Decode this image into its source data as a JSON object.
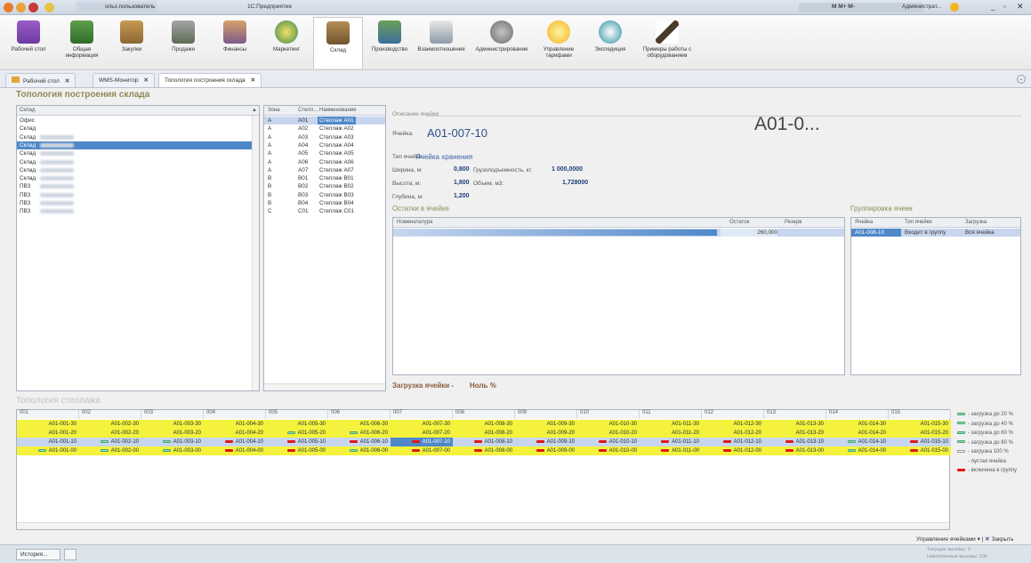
{
  "window": {
    "title_user": "ольз.пользователь",
    "title_app": "1С:Предприятие",
    "user": "Администрат..."
  },
  "ribbon": [
    {
      "label": "Рабочий стол",
      "icon": "desktop-icon"
    },
    {
      "label": "Общая информация",
      "icon": "info-icon"
    },
    {
      "label": "Закупки",
      "icon": "purchases-icon"
    },
    {
      "label": "Продажи",
      "icon": "sales-icon"
    },
    {
      "label": "Финансы",
      "icon": "finance-icon"
    },
    {
      "label": "Маркетинг",
      "icon": "marketing-icon"
    },
    {
      "label": "Склад",
      "icon": "warehouse-icon"
    },
    {
      "label": "Производство",
      "icon": "production-icon"
    },
    {
      "label": "Взаимоотношения",
      "icon": "relations-icon"
    },
    {
      "label": "Администрирование",
      "icon": "admin-icon"
    },
    {
      "label": "Управление тарифами",
      "icon": "tariff-icon"
    },
    {
      "label": "Экспедиция",
      "icon": "expedition-icon"
    },
    {
      "label": "Примеры работы с оборудованием",
      "icon": "equipment-icon"
    }
  ],
  "tabs": [
    "Рабочий стол",
    "WMS-Монитор",
    "Топология построения склада"
  ],
  "page_title": "Топология построения склада",
  "warehouses": {
    "header": "Склад",
    "items": [
      "Офис",
      "Склад",
      "Склад",
      "Склад",
      "Склад",
      "Склад",
      "Склад",
      "Склад",
      "ПВЗ",
      "ПВЗ",
      "ПВЗ",
      "ПВЗ"
    ]
  },
  "racks": {
    "headers": [
      "Зона",
      "Стелл...",
      "Наименование"
    ],
    "rows": [
      [
        "A",
        "A01",
        "Стеллаж A01"
      ],
      [
        "A",
        "A02",
        "Стеллаж A02"
      ],
      [
        "A",
        "A03",
        "Стеллаж A03"
      ],
      [
        "A",
        "A04",
        "Стеллаж A04"
      ],
      [
        "A",
        "A05",
        "Стеллаж A05"
      ],
      [
        "A",
        "A06",
        "Стеллаж A06"
      ],
      [
        "A",
        "A07",
        "Стеллаж A07"
      ],
      [
        "B",
        "B01",
        "Стеллаж B01"
      ],
      [
        "B",
        "B02",
        "Стеллаж B02"
      ],
      [
        "B",
        "B03",
        "Стеллаж B03"
      ],
      [
        "B",
        "B04",
        "Стеллаж B04"
      ],
      [
        "C",
        "C01",
        "Стеллаж C01"
      ]
    ]
  },
  "cell": {
    "section": "Описание ячейки",
    "cell_label": "Ячейка:",
    "cell_value": "A01-007-10",
    "big": "A01-0...",
    "type_label": "Тип ячейки:",
    "type_value": "Ячейка хранения",
    "width_label": "Ширина, м:",
    "width": "0,800",
    "capacity_label": "Грузоподъемность, кг:",
    "capacity": "1 000,0000",
    "height_label": "Высота, м:",
    "height": "1,800",
    "volume_label": "Объем, м3:",
    "volume": "1,728000",
    "depth_label": "Глубина, м:",
    "depth": "1,200",
    "load_label": "Загрузка ячейки -",
    "load_value": "Ноль  %"
  },
  "stock": {
    "title": "Остатки в ячейке",
    "headers": [
      "Номенклатура",
      "Остаток",
      "Резерв"
    ],
    "row": {
      "name": "",
      "rest": "260,000",
      "reserve": ""
    }
  },
  "grouping": {
    "title": "Группировка ячеек",
    "headers": [
      "Ячейка",
      "Тип ячейки",
      "Загрузка"
    ],
    "row": [
      "A01-008-10",
      "Входит в группу",
      "Вся ячейка"
    ]
  },
  "topology": {
    "title": "Топология стеллажа",
    "columns": [
      "001",
      "002",
      "003",
      "004",
      "005",
      "006",
      "007",
      "008",
      "009",
      "010",
      "011",
      "012",
      "013",
      "014",
      "015"
    ]
  },
  "legend": [
    "- загрузка до 20 %",
    "- загрузка до 40 %",
    "- загрузка до 60 %",
    "- загрузка до 80 %",
    "- загрузка 100 %",
    "- пустая ячейка",
    "- включена в группу"
  ],
  "footer": {
    "manage": "Управление ячейками",
    "close": "Закрыть",
    "history": "История...",
    "calls1": "Текущие вызовы: 0",
    "calls2": "Накопленные вызовы: 106"
  }
}
